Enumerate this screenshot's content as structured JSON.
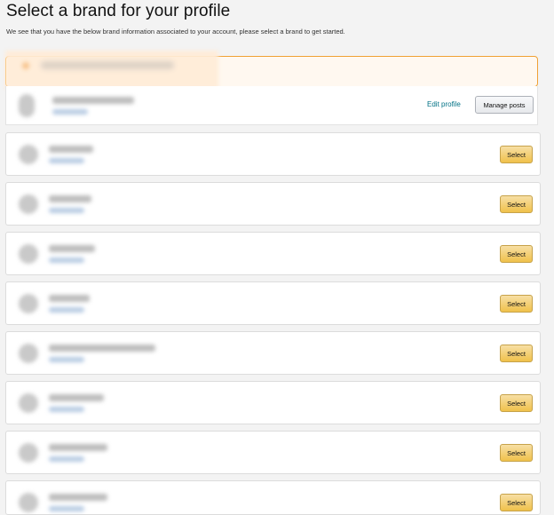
{
  "header": {
    "title": "Select a brand for your profile",
    "subtitle": "We see that you have the below brand information associated to your account, please select a brand to get started."
  },
  "profile": {
    "edit_label": "Edit profile",
    "manage_label": "Manage posts"
  },
  "brands": {
    "select_label": "Select"
  },
  "colors": {
    "alert_border": "#f0a134",
    "link": "#007185",
    "select_button": "#f0c14b"
  }
}
